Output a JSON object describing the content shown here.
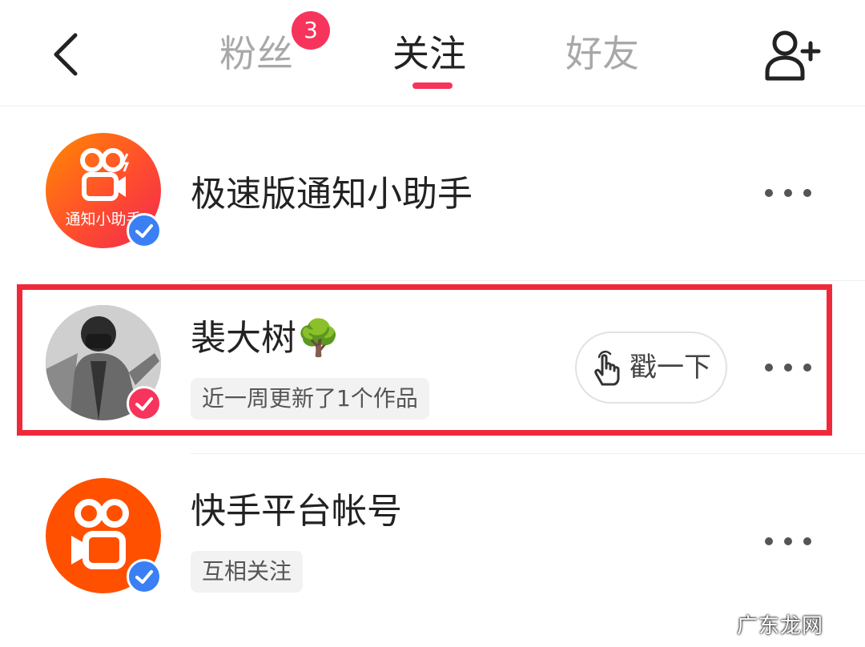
{
  "header": {
    "back_icon": "chevron-left-icon",
    "tabs": [
      {
        "label": "粉丝",
        "badge": "3",
        "active": false
      },
      {
        "label": "关注",
        "active": true
      },
      {
        "label": "好友",
        "active": false
      }
    ],
    "add_friend_icon": "add-user-icon"
  },
  "list": [
    {
      "avatar_text": "通知小助手",
      "avatar_icon": "kuaishou-camera-icon",
      "verify_color": "#3b7ff5",
      "name": "极速版通知小助手",
      "more_icon": "more-dots-icon"
    },
    {
      "avatar_icon": "user-photo",
      "verify_color": "#f7345c",
      "name": "裴大树",
      "name_emoji": "🌳",
      "subtitle": "近一周更新了1个作品",
      "poke_label": "戳一下",
      "poke_icon": "tap-hand-icon",
      "more_icon": "more-dots-icon",
      "highlighted": true
    },
    {
      "avatar_icon": "kuaishou-camera-icon",
      "verify_color": "#3b7ff5",
      "name": "快手平台帐号",
      "subtitle": "互相关注",
      "more_icon": "more-dots-icon"
    }
  ],
  "watermark": "广东龙网",
  "colors": {
    "accent": "#f7345c",
    "highlight_border": "#ee2a3a",
    "verify_blue": "#3b7ff5",
    "brand_orange": "#ff5000"
  }
}
